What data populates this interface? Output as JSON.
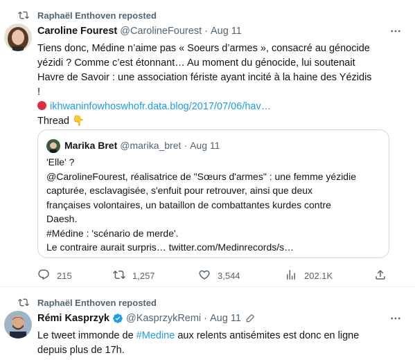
{
  "tweets": [
    {
      "repost_label": "Raphaël Enthoven reposted",
      "author_name": "Caroline Fourest",
      "author_handle": "@CarolineFourest",
      "dot": "·",
      "time": "Aug 11",
      "more_label": "More",
      "text_lines": [
        "Tiens donc, Médine n’aime pas « Soeurs d’armes », consacré au génocide",
        "yézidi ? Comme c’est étonnant… Au moment du génocide, lui soutenait",
        "Havre de Savoir : une association fériste ayant incité à la haine des Yézidis",
        "!"
      ],
      "link_text": "ikhwaninfowhoswhofr.data.blog/2017/07/06/hav…",
      "thread_text": "Thread 👇",
      "quote": {
        "author_name": "Marika Bret",
        "author_handle": "@marika_bret",
        "dot": "·",
        "time": "Aug 11",
        "lines": [
          "'Elle' ?",
          "@CarolineFourest, réalisatrice de \"Sœurs d'armes\" : une femme yézidie",
          "capturée, esclavagisée, s'enfuit pour retrouver, ainsi que deux",
          "françaises volontaires, un bataillon de combattantes kurdes contre",
          "Daesh.",
          "#Médine : 'scénario de merde'.",
          "Le contraire aurait surpris… twitter.com/Medinrecords/s…"
        ]
      },
      "actions": {
        "replies": "215",
        "reposts": "1,257",
        "likes": "3,544",
        "views": "202.1K"
      }
    },
    {
      "repost_label": "Raphaël Enthoven reposted",
      "author_name": "Rémi Kasprzyk",
      "author_handle": "@KasprzykRemi",
      "dot": "·",
      "time": "Aug 11",
      "text_prefix": "Le tweet immonde de ",
      "hashtag": "#Medine",
      "text_suffix": " aux relents antisémites est donc en ligne",
      "text_line2": "depuis plus de 17h."
    }
  ],
  "colors": {
    "link": "#1d9bf0",
    "muted": "#536471",
    "text": "#0f1419",
    "border": "#cfd9de"
  }
}
